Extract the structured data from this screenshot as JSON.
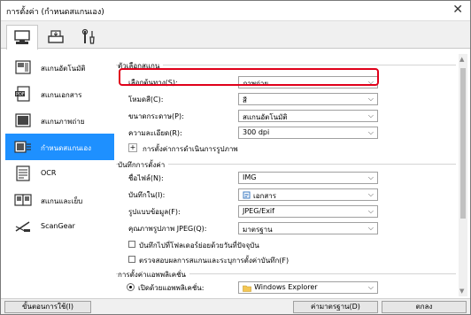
{
  "window": {
    "title": "การตั้งค่า (กำหนดสแกนเอง)",
    "close": "✕"
  },
  "toptabs": [
    {
      "name": "scan-from-computer",
      "icon": "computer-scan-icon"
    },
    {
      "name": "scan-from-panel",
      "icon": "scanner-panel-icon"
    },
    {
      "name": "general-settings",
      "icon": "tools-icon"
    }
  ],
  "sidebar": {
    "items": [
      {
        "label": "สแกนอัตโนมัติ",
        "icon": "auto-scan-icon"
      },
      {
        "label": "สแกนเอกสาร",
        "icon": "pdf-document-icon"
      },
      {
        "label": "สแกนภาพถ่าย",
        "icon": "photo-icon"
      },
      {
        "label": "กำหนดสแกนเอง",
        "icon": "custom-scan-icon"
      },
      {
        "label": "OCR",
        "icon": "ocr-icon"
      },
      {
        "label": "สแกนและเย็บ",
        "icon": "stitch-icon"
      },
      {
        "label": "ScanGear",
        "icon": "scangear-icon"
      }
    ],
    "active_index": 3
  },
  "scan_options": {
    "title": "ตัวเลือกสแกน",
    "select_source_label": "เลือกต้นทาง(S):",
    "select_source_value": "ภาพถ่าย",
    "color_mode_label": "โหมดสี(C):",
    "color_mode_value": "สี",
    "paper_size_label": "ขนาดกระดาษ(P):",
    "paper_size_value": "สแกนอัตโนมัติ",
    "resolution_label": "ความละเอียด(R):",
    "resolution_value": "300 dpi",
    "image_processing_label": "การตั้งค่าการดำเนินการรูปภาพ",
    "expand": "+"
  },
  "save_settings": {
    "title": "บันทึกการตั้งค่า",
    "file_name_label": "ชื่อไฟล์(N):",
    "file_name_value": "IMG",
    "save_in_label": "บันทึกใน(I):",
    "save_in_value": "เอกสาร",
    "data_format_label": "รูปแบบข้อมูล(F):",
    "data_format_value": "JPEG/Exif",
    "jpeg_quality_label": "คุณภาพรูปภาพ JPEG(Q):",
    "jpeg_quality_value": "มาตรฐาน",
    "subfolder_label": "บันทึกไปที่โฟลเดอร์ย่อยด้วยวันที่ปัจจุบัน",
    "subfolder_checked": false,
    "check_results_label": "ตรวจสอบผลการสแกนและระบุการตั้งค่าบันทึก(F)",
    "check_results_checked": false
  },
  "app_settings": {
    "title": "การตั้งค่าแอพพลิเคชั่น",
    "open_with_label": "เปิดด้วยแอพพลิเคชั่น:",
    "open_with_value": "Windows Explorer"
  },
  "buttons": {
    "instructions": "ขั้นตอนการใช้(I)",
    "defaults": "ค่ามาตรฐาน(D)",
    "ok": "ตกลง"
  },
  "colors": {
    "active_nav": "#1e90ff",
    "highlight": "#e0001a"
  }
}
